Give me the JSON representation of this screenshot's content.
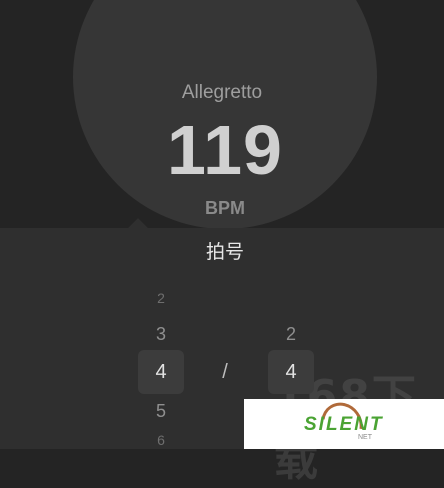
{
  "metronome": {
    "tempo_name": "Allegretto",
    "bpm_value": "119",
    "bpm_unit": "BPM"
  },
  "time_signature_sheet": {
    "title": "拍号",
    "separator": "/",
    "numerator": {
      "items": [
        "2",
        "3",
        "5",
        "6"
      ],
      "selected": "4"
    },
    "denominator": {
      "items": [
        "2"
      ],
      "selected": "4"
    }
  },
  "watermark": {
    "text": "168下载",
    "logo_text": "SILENT",
    "logo_sub": "NET"
  },
  "colors": {
    "background": "#242424",
    "circle": "#363636",
    "sheet": "#2f2f2f",
    "selection": "#3c3c3c",
    "logo_green": "#4aa333"
  }
}
